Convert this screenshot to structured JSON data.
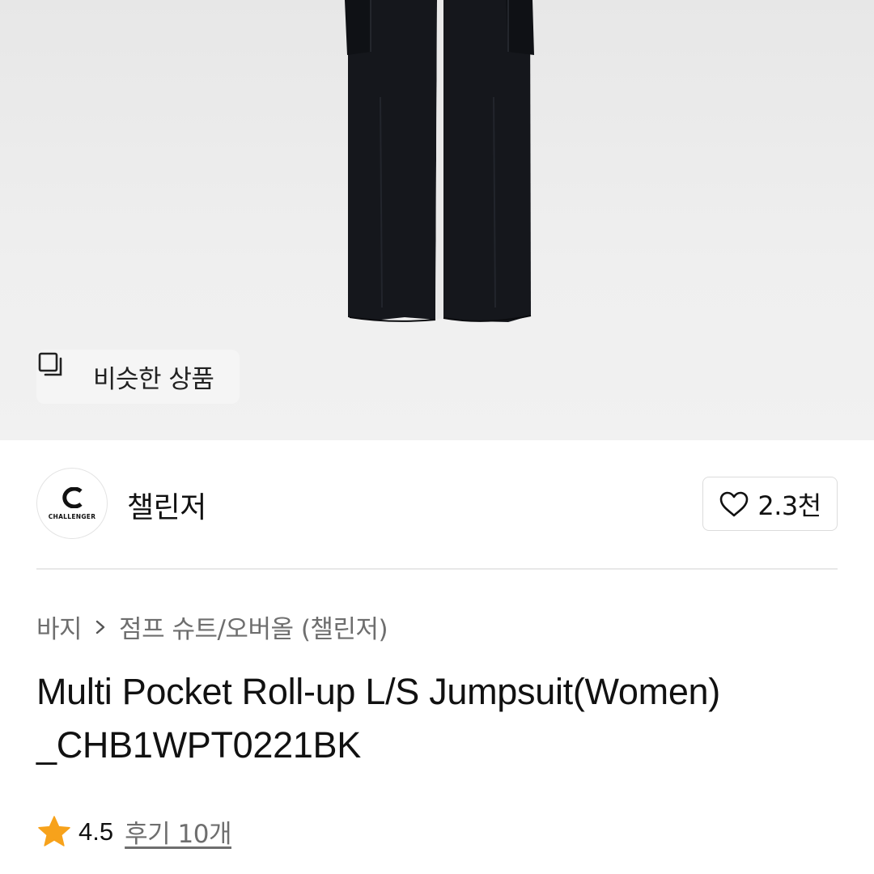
{
  "hero": {
    "image_name": "black-cargo-jumpsuit-image",
    "similar_button_label": "비슷한 상품",
    "similar_icon": "similar-items-icon"
  },
  "brand": {
    "name": "챌린저",
    "logo_text": "CHALLENGER",
    "like_count": "2.3천",
    "like_icon": "heart-outline-icon"
  },
  "breadcrumb": {
    "items": [
      "바지",
      "점프 슈트/오버올 (챌린저)"
    ],
    "separator_icon": "chevron-right-icon"
  },
  "product": {
    "title_line1": "Multi Pocket Roll-up L/S Jumpsuit(Women)",
    "title_line2": "_CHB1WPT0221BK"
  },
  "rating": {
    "score": "4.5",
    "reviews_label": "후기 10개",
    "star_icon": "star-icon",
    "star_color": "#f7a21b"
  },
  "colors": {
    "garment": "#15171c",
    "hero_bg": "#ececec",
    "muted_text": "#6e6e6e"
  }
}
